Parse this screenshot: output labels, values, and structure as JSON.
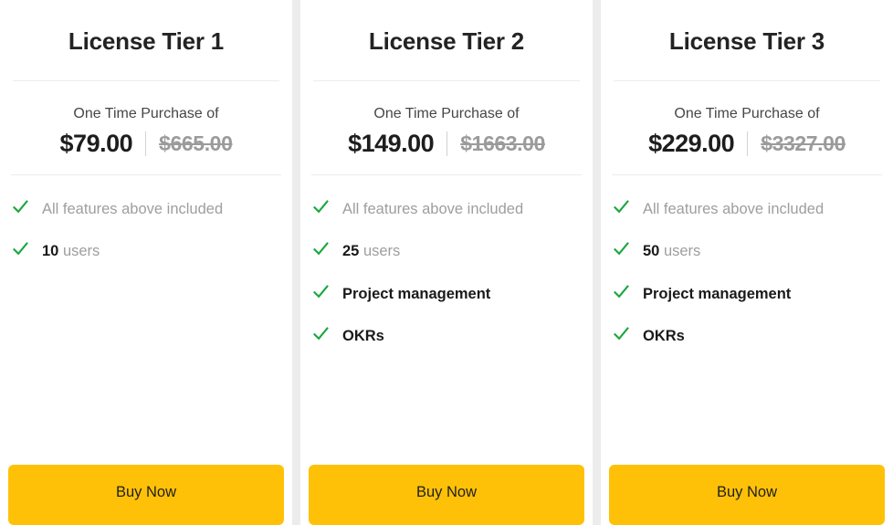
{
  "theme": {
    "page_background": "#ececec",
    "card_background": "#ffffff",
    "accent_button": "#ffc107",
    "check_green": "#19a73e",
    "muted_text": "#9e9e9e",
    "strong_text": "#1a1a1a",
    "divider": "#ececec"
  },
  "icons": {
    "check": "check-icon"
  },
  "tiers": [
    {
      "title": "License Tier 1",
      "price_caption": "One Time Purchase of",
      "price_current": "$79.00",
      "price_old": "$665.00",
      "buy_label": "Buy Now",
      "features": [
        {
          "lead": "",
          "text": "All features above included",
          "style": "muted"
        },
        {
          "lead": "10",
          "text": " users",
          "style": "lead-bold"
        }
      ]
    },
    {
      "title": "License Tier 2",
      "price_caption": "One Time Purchase of",
      "price_current": "$149.00",
      "price_old": "$1663.00",
      "buy_label": "Buy Now",
      "features": [
        {
          "lead": "",
          "text": "All features above included",
          "style": "muted"
        },
        {
          "lead": "25",
          "text": " users",
          "style": "lead-bold"
        },
        {
          "lead": "",
          "text": "Project management",
          "style": "bold"
        },
        {
          "lead": "",
          "text": "OKRs",
          "style": "bold"
        }
      ]
    },
    {
      "title": "License Tier 3",
      "price_caption": "One Time Purchase of",
      "price_current": "$229.00",
      "price_old": "$3327.00",
      "buy_label": "Buy Now",
      "features": [
        {
          "lead": "",
          "text": "All features above included",
          "style": "muted"
        },
        {
          "lead": "50",
          "text": " users",
          "style": "lead-bold"
        },
        {
          "lead": "",
          "text": "Project management",
          "style": "bold"
        },
        {
          "lead": "",
          "text": "OKRs",
          "style": "bold"
        }
      ]
    }
  ]
}
